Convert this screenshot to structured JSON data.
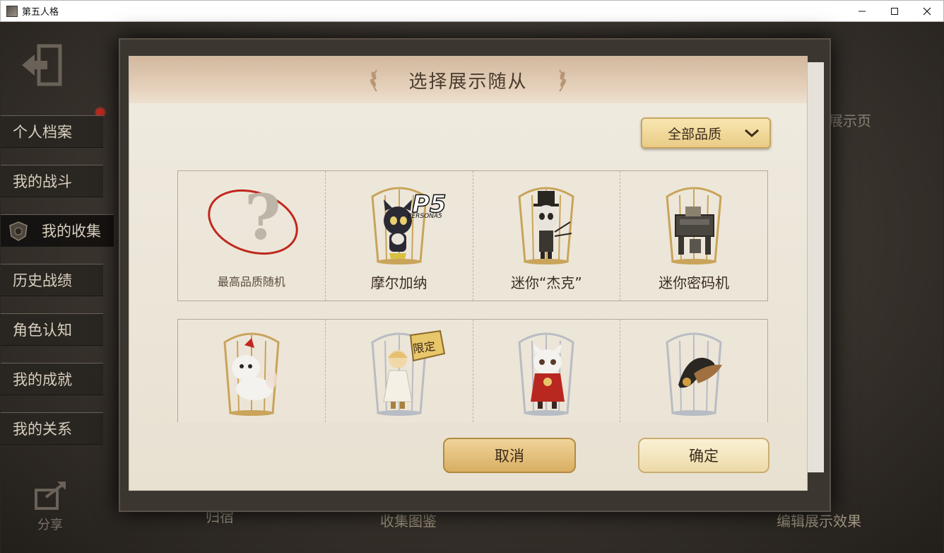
{
  "window": {
    "title": "第五人格",
    "minimize": "—",
    "maximize": "☐",
    "close": "✕"
  },
  "sidebar": {
    "items": [
      {
        "label": "个人档案"
      },
      {
        "label": "我的战斗"
      },
      {
        "label": "我的收集"
      },
      {
        "label": "历史战绩"
      },
      {
        "label": "角色认知"
      },
      {
        "label": "我的成就"
      },
      {
        "label": "我的关系"
      }
    ],
    "share_label": "分享"
  },
  "background": {
    "tab_home": "归宿",
    "tab_collection": "收集图鉴",
    "edit_display": "编辑展示效果",
    "display_page": "展示页"
  },
  "dialog": {
    "title": "选择展示随从",
    "filter": {
      "selected": "全部品质"
    },
    "row1": [
      {
        "label": "最高品质随机",
        "icon": "random-question-icon"
      },
      {
        "label": "摩尔加纳",
        "icon": "morgana-pet-icon",
        "brand": "P5 PERSONA5"
      },
      {
        "label": "迷你“杰克”",
        "icon": "mini-jack-pet-icon"
      },
      {
        "label": "迷你密码机",
        "icon": "mini-cipher-machine-icon"
      }
    ],
    "row2": [
      {
        "label": "",
        "icon": "white-fox-pet-icon"
      },
      {
        "label": "",
        "icon": "angel-doll-pet-icon",
        "badge": "限定"
      },
      {
        "label": "",
        "icon": "red-cape-fox-pet-icon"
      },
      {
        "label": "",
        "icon": "black-feather-pet-icon"
      }
    ],
    "cancel_label": "取消",
    "confirm_label": "确定"
  },
  "colors": {
    "dialog_bg": "#ece6d8",
    "header_bg": "#d2b89e",
    "gold_button": "#e9cc86",
    "cage_gold": "#c9a45a",
    "cage_silver": "#b8bcc4"
  }
}
